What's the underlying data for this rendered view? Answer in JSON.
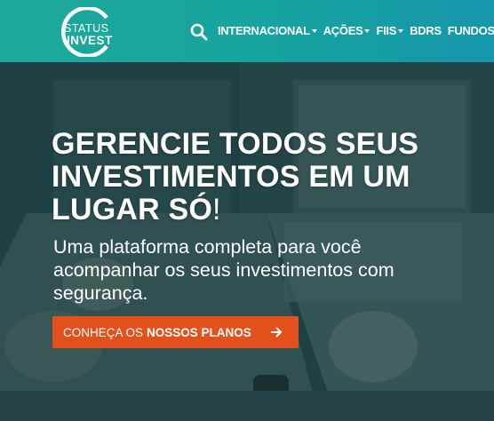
{
  "brand": {
    "line1": "STATUS",
    "line2": "INVEST"
  },
  "nav": {
    "items": [
      {
        "label": "INTERNACIONAL",
        "dropdown": true
      },
      {
        "label": "AÇÕES",
        "dropdown": true
      },
      {
        "label": "FIIS",
        "dropdown": true
      },
      {
        "label": "BDRS",
        "dropdown": false
      },
      {
        "label": "FUNDOS",
        "dropdown": true
      }
    ]
  },
  "hero": {
    "headline_line1": "GERENCIE TODOS SEUS",
    "headline_line2": "INVESTIMENTOS EM UM",
    "headline_line3": "LUGAR SÓ",
    "headline_bang": "!",
    "subtext_line1": "Uma plataforma completa para você",
    "subtext_line2": "acompanhar os seus investimentos com",
    "subtext_line3": "segurança.",
    "cta_prefix": "CONHEÇA OS",
    "cta_strong": "NOSSOS PLANOS"
  },
  "colors": {
    "navbar_start": "#1ea99a",
    "navbar_end": "#1596aa",
    "cta": "#e2511c"
  },
  "icons": [
    "search-icon",
    "chevron-down-icon",
    "arrow-right-icon"
  ]
}
